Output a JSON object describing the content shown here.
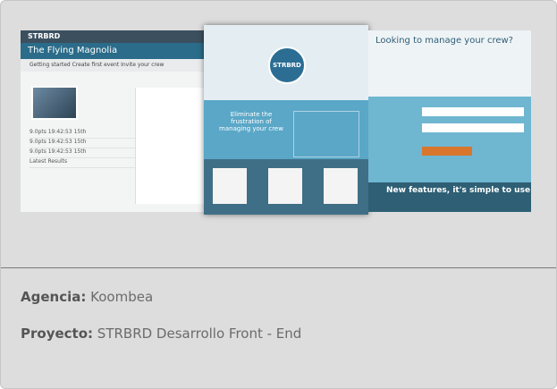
{
  "left_screenshot": {
    "brand": "STRBRD",
    "title": "The Flying Magnolia",
    "steps": "Getting started   Create first event   Invite your crew",
    "rows": [
      "9.0pts 19:42:53 15th",
      "9.0pts 19:42:53 15th",
      "9.0pts 19:42:53 15th",
      "Latest Results"
    ]
  },
  "middle_screenshot": {
    "logo_text": "STRBRD",
    "message": "Eliminate the frustration of managing your crew"
  },
  "right_screenshot": {
    "heading": "Looking to manage your crew?",
    "bottom_text": "New features, it's simple to use"
  },
  "credits": {
    "agency_label": "Agencia:",
    "agency_value": "Koombea",
    "project_label": "Proyecto:",
    "project_value": "STRBRD Desarrollo Front - End"
  }
}
